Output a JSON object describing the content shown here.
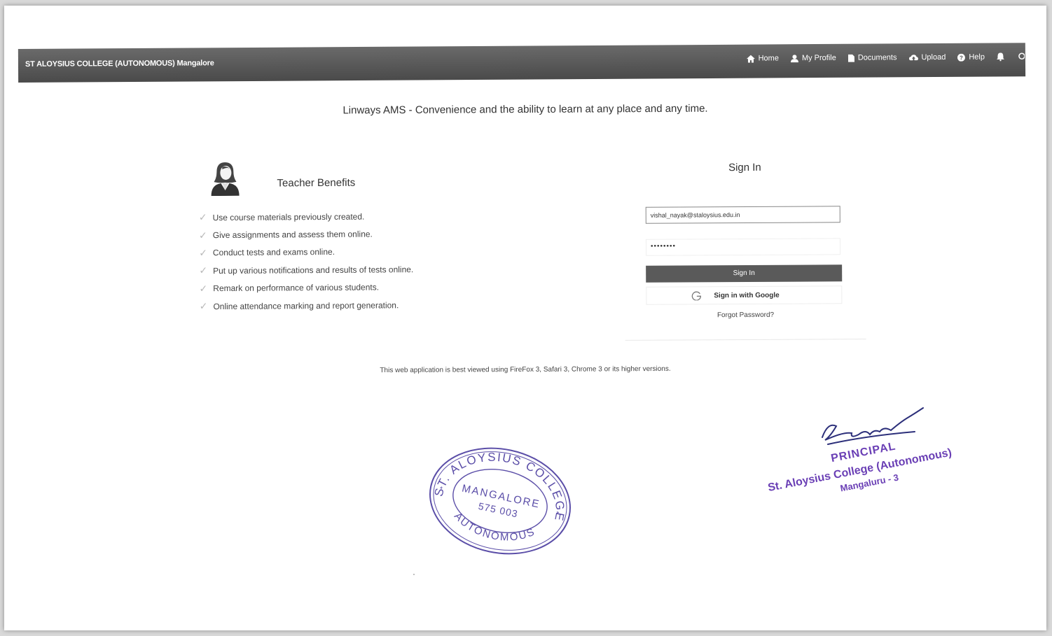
{
  "navbar": {
    "brand": "ST ALOYSIUS COLLEGE (AUTONOMOUS) Mangalore",
    "links": [
      {
        "label": "Home",
        "icon": "home-icon"
      },
      {
        "label": "My Profile",
        "icon": "user-icon"
      },
      {
        "label": "Documents",
        "icon": "document-icon"
      },
      {
        "label": "Upload",
        "icon": "upload-icon"
      },
      {
        "label": "Help",
        "icon": "help-icon"
      }
    ]
  },
  "tagline": "Linways AMS - Convenience and the ability to learn at any place and any time.",
  "benefits": {
    "title": "Teacher Benefits",
    "items": [
      "Use course materials previously created.",
      "Give assignments and assess them online.",
      "Conduct tests and exams online.",
      "Put up various notifications and results of tests online.",
      "Remark on performance of various students.",
      "Online attendance marking and report generation."
    ]
  },
  "signin": {
    "title": "Sign In",
    "email_value": "vishal_nayak@staloysius.edu.in",
    "password_value": "••••••••",
    "signin_label": "Sign In",
    "google_label": "Sign in with Google",
    "forgot_label": "Forgot Password?"
  },
  "footer_note": "This web application is best viewed using FireFox 3, Safari 3, Chrome 3 or its higher versions.",
  "seal": {
    "top_text": "ST. ALOYSIUS COLLEGE",
    "city": "MANGALORE",
    "pin": "575 003",
    "bottom_text": "AUTONOMOUS",
    "color": "#5b4ea8"
  },
  "stamp": {
    "line1": "PRINCIPAL",
    "line2": "St. Aloysius College (Autonomous)",
    "line3": "Mangaluru - 3",
    "color": "#6a3fb5"
  },
  "colors": {
    "navbar": "#555555",
    "button": "#5a5a5a"
  }
}
